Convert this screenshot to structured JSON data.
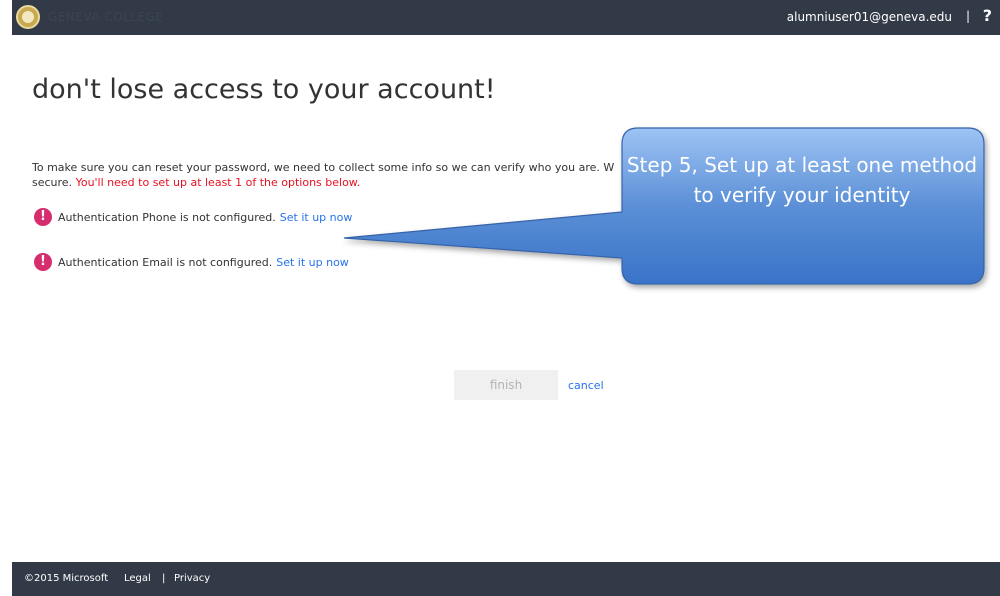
{
  "header": {
    "org_name": "GENEVA COLLEGE",
    "user_email": "alumniuser01@geneva.edu",
    "separator": "|",
    "help_label": "?"
  },
  "main": {
    "title": "don't lose access to your account!",
    "intro_text": "To make sure you can reset your password, we need to collect some info so we can verify who you are. W",
    "intro_text_2": "secure.",
    "required_note": "You'll need to set up at least 1 of the options below.",
    "methods": [
      {
        "text": "Authentication Phone is not configured.",
        "link_label": "Set it up now"
      },
      {
        "text": "Authentication Email is not configured.",
        "link_label": "Set it up now"
      }
    ],
    "finish_label": "finish",
    "cancel_label": "cancel"
  },
  "callout": {
    "text": "Step 5, Set up at least one method to verify your identity"
  },
  "footer": {
    "copyright": "©2015 Microsoft",
    "legal_label": "Legal",
    "separator": "|",
    "privacy_label": "Privacy"
  },
  "colors": {
    "topbar_bg": "#323a47",
    "accent_link": "#2672ec",
    "required_red": "#e81123",
    "alert_icon": "#d62d6e",
    "callout_fill": "#5b8fd6"
  },
  "icons": {
    "logo": "college-seal-icon",
    "help": "help-icon",
    "alert": "alert-icon"
  }
}
